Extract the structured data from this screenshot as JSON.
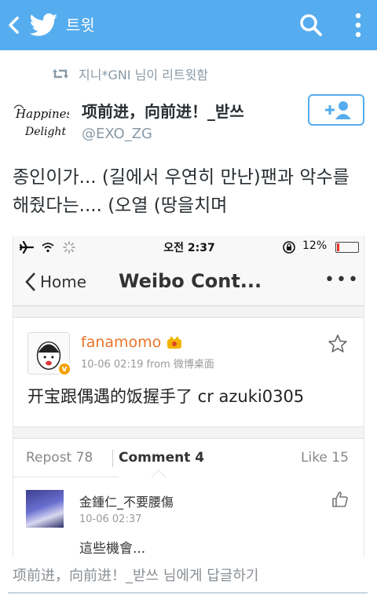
{
  "appbar": {
    "title": "트윗",
    "back_icon": "chevron-left-icon",
    "logo_icon": "twitter-bird-icon",
    "search_icon": "search-icon",
    "more_icon": "vertical-dots-icon",
    "background": "#55acee"
  },
  "retweet": {
    "text": "지니*GNI 님이 리트윗함",
    "icon": "retweet-icon"
  },
  "author": {
    "name": "项前进，向前进！_받쓰",
    "handle": "@EXO_ZG",
    "avatar_text": "Happiness Delight",
    "follow_icon": "add-user-icon"
  },
  "tweet": {
    "text": "종인이가... (길에서 우연히 만난)팬과 악수를 해줬다는.... (오열 (땅을치며"
  },
  "embedded": {
    "status": {
      "time": "오전 2:37",
      "battery": "12%",
      "battery_level": 0.12
    },
    "nav": {
      "back_label": "Home",
      "title": "Weibo Cont...",
      "more": "•••"
    },
    "post": {
      "user": "fanamomo",
      "meta": "10-06 02:19  from 微博桌面",
      "body": "开宝跟偶遇的饭握手了 cr azuki0305",
      "verified_badge": "v"
    },
    "tabs": {
      "repost": "Repost 78",
      "comment": "Comment 4",
      "like": "Like 15"
    },
    "comment": {
      "user": "金鍾仁_不要腰傷",
      "time": "10-06 02:37",
      "text": "這些機會..."
    }
  },
  "reply": {
    "placeholder": "项前进，向前进！_받쓰 님에게 답글하기"
  }
}
